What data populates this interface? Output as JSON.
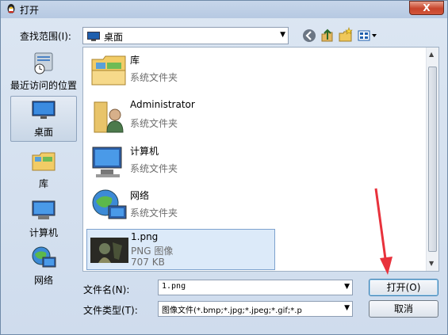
{
  "window": {
    "title": "打开",
    "close_label": "X"
  },
  "lookin": {
    "label": "查找范围(I):",
    "value": "桌面"
  },
  "places": [
    {
      "label": "最近访问的位置"
    },
    {
      "label": "桌面"
    },
    {
      "label": "库"
    },
    {
      "label": "计算机"
    },
    {
      "label": "网络"
    }
  ],
  "files": [
    {
      "name": "库",
      "type": "系统文件夹"
    },
    {
      "name": "Administrator",
      "type": "系统文件夹"
    },
    {
      "name": "计算机",
      "type": "系统文件夹"
    },
    {
      "name": "网络",
      "type": "系统文件夹"
    },
    {
      "name": "1.png",
      "type": "PNG 图像",
      "size": "707 KB"
    }
  ],
  "filename": {
    "label": "文件名(N):",
    "value": "1.png"
  },
  "filetype": {
    "label": "文件类型(T):",
    "value": "图像文件(*.bmp;*.jpg;*.jpeg;*.gif;*.p"
  },
  "buttons": {
    "open": "打开(O)",
    "cancel": "取消"
  },
  "colors": {
    "annotation_arrow": "#e8323c",
    "selection": "#dceaf9"
  },
  "icons": {
    "toolbar": [
      "back-icon",
      "up-folder-icon",
      "new-folder-icon",
      "views-menu-icon"
    ]
  }
}
